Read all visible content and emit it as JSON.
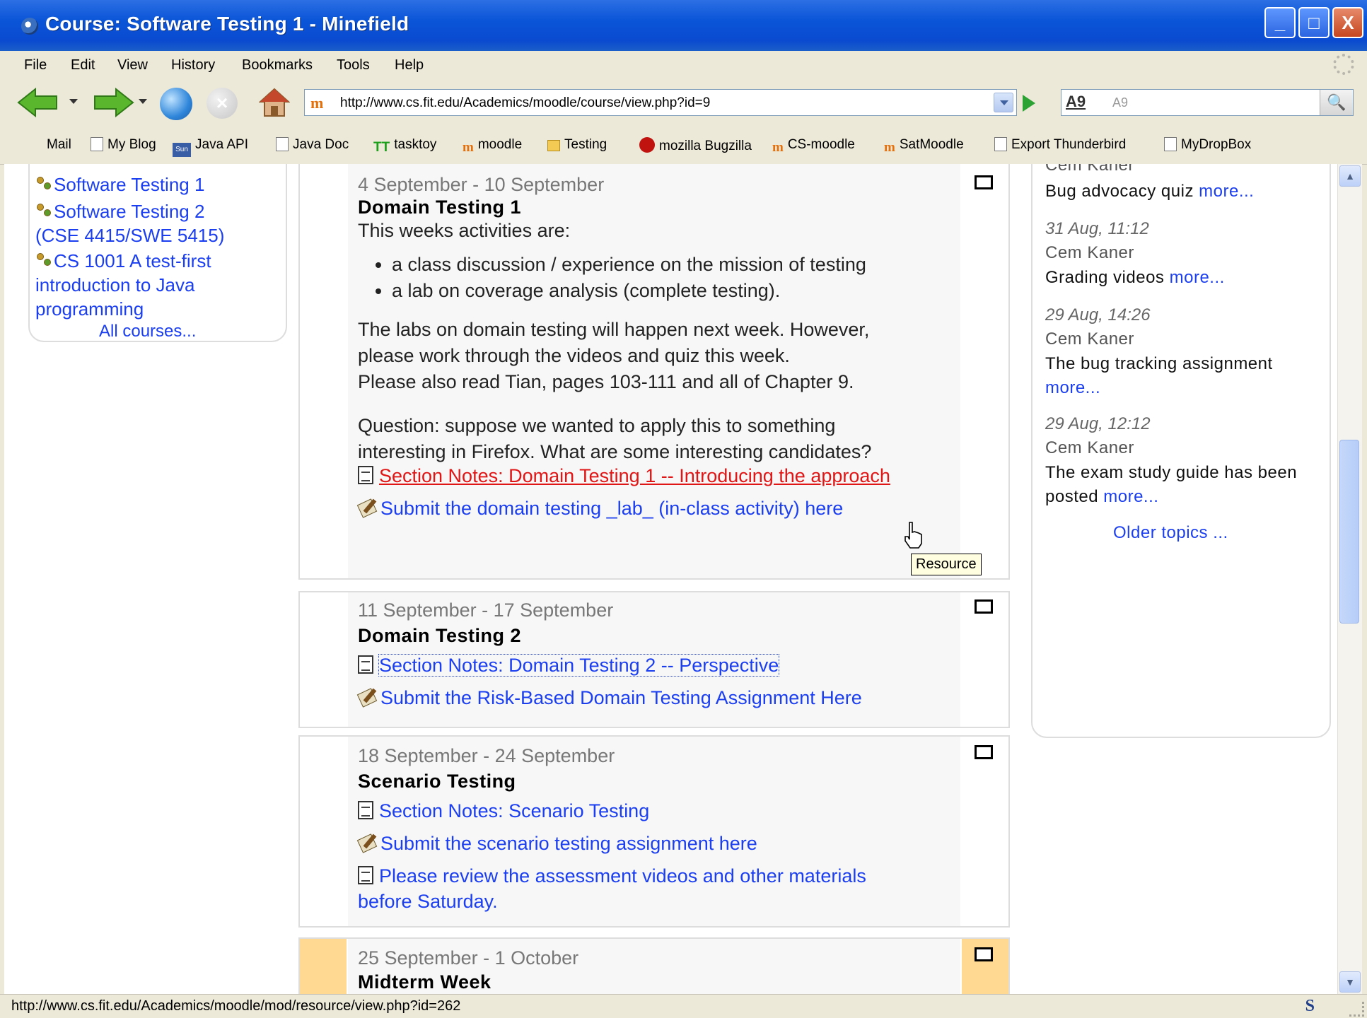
{
  "window": {
    "title": "Course: Software Testing 1 - Minefield",
    "controls": {
      "minimize": "_",
      "maximize": "□",
      "close": "X"
    }
  },
  "menu": [
    "File",
    "Edit",
    "View",
    "History",
    "Bookmarks",
    "Tools",
    "Help"
  ],
  "navbar": {
    "url_favicon": "m",
    "url": "http://www.cs.fit.edu/Academics/moodle/course/view.php?id=9",
    "search_engine": "A9",
    "search_placeholder": "A9",
    "search_icon": "🔍",
    "stop_glyph": "×"
  },
  "bookmarks": [
    {
      "label": "Mail",
      "icon": "none"
    },
    {
      "label": "My Blog",
      "icon": "page"
    },
    {
      "label": "Java API",
      "icon": "sun"
    },
    {
      "label": "Java Doc",
      "icon": "page"
    },
    {
      "label": "tasktoy",
      "icon": "tt"
    },
    {
      "label": "moodle",
      "icon": "moodle"
    },
    {
      "label": "Testing",
      "icon": "folder"
    },
    {
      "label": "mozilla Bugzilla",
      "icon": "bug"
    },
    {
      "label": "CS-moodle",
      "icon": "moodle"
    },
    {
      "label": "SatMoodle",
      "icon": "moodle"
    },
    {
      "label": "Export Thunderbird",
      "icon": "page"
    },
    {
      "label": "MyDropBox",
      "icon": "page"
    }
  ],
  "bookmark_icon_text": {
    "sun": "Sun",
    "tt": "TT",
    "moodle": "m"
  },
  "courses": {
    "items": [
      "Software Testing 1",
      "Software Testing 2",
      "(CSE 4415/SWE 5415)",
      "CS 1001 A test-first",
      "introduction to Java",
      "programming"
    ],
    "all_courses": "All courses..."
  },
  "sections": [
    {
      "date": "4 September - 10 September",
      "title": "Domain Testing 1",
      "intro": "This weeks activities are:",
      "bullets": [
        "a class discussion / experience on the mission of testing",
        "a lab on coverage analysis (complete testing)."
      ],
      "para1": [
        "The labs on domain testing will happen next week. However,",
        "please work through the videos and quiz this week.",
        "Please also read Tian, pages 103-111 and all of Chapter 9."
      ],
      "para2": [
        "Question: suppose we wanted to apply this to something",
        "interesting in Firefox. What are some interesting candidates?"
      ],
      "resource": "Section Notes: Domain Testing 1 -- Introducing the approach",
      "assignment": "Submit the domain testing _lab_ (in-class activity) here"
    },
    {
      "date": "11 September - 17 September",
      "title": "Domain Testing 2",
      "resource": "Section Notes: Domain Testing 2 -- Perspective",
      "assignment": "Submit the Risk-Based Domain Testing Assignment Here"
    },
    {
      "date": "18 September - 24 September",
      "title": "Scenario Testing",
      "resource": "Section Notes: Scenario Testing",
      "assignment": "Submit the scenario testing assignment here",
      "resource2_line1": "Please review the assessment videos and other materials",
      "resource2_line2": "before Saturday."
    },
    {
      "date": "25 September - 1 October",
      "title": "Midterm Week"
    }
  ],
  "news": {
    "item0": {
      "author": "Cem Kaner",
      "text": "Bug advocacy quiz"
    },
    "item1": {
      "date": "31 Aug, 11:12",
      "author": "Cem Kaner",
      "text": "Grading videos"
    },
    "item2": {
      "date": "29 Aug, 14:26",
      "author": "Cem Kaner",
      "text": "The bug tracking assignment"
    },
    "item3": {
      "date": "29 Aug, 12:12",
      "author": "Cem Kaner",
      "text_line1": "The exam study guide has been",
      "text_line2": "posted"
    },
    "more": "more...",
    "older": "Older topics ..."
  },
  "tooltip": "Resource",
  "status": {
    "url": "http://www.cs.fit.edu/Academics/moodle/mod/resource/view.php?id=262",
    "s_icon": "S"
  },
  "scroll": {
    "up": "▲",
    "down": "▼"
  }
}
